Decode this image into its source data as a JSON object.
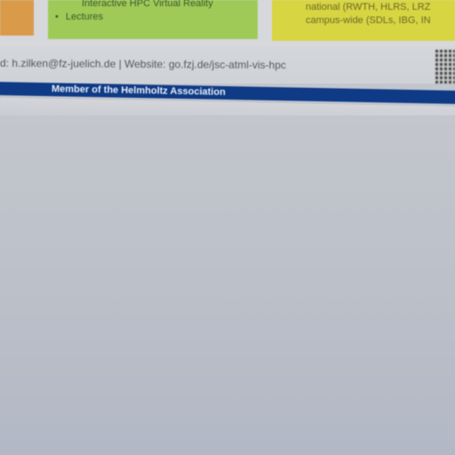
{
  "poster": {
    "green_box": {
      "line1": "Interactive  HPC  Virtual Reality",
      "bullet": "•",
      "line2": "Lectures"
    },
    "yellow_box": {
      "line1": "national (RWTH, HLRS, LRZ",
      "line2": "campus-wide (SDLs, IBG, IN"
    },
    "contact": "d: h.zilken@fz-juelich.de | Website: go.fzj.de/jsc-atml-vis-hpc",
    "banner": "Member of the Helmholtz Association",
    "colors": {
      "orange_box": "#d99a4a",
      "green_box": "#9fca58",
      "yellow_box": "#d8d542",
      "banner": "#0e3a86"
    }
  }
}
